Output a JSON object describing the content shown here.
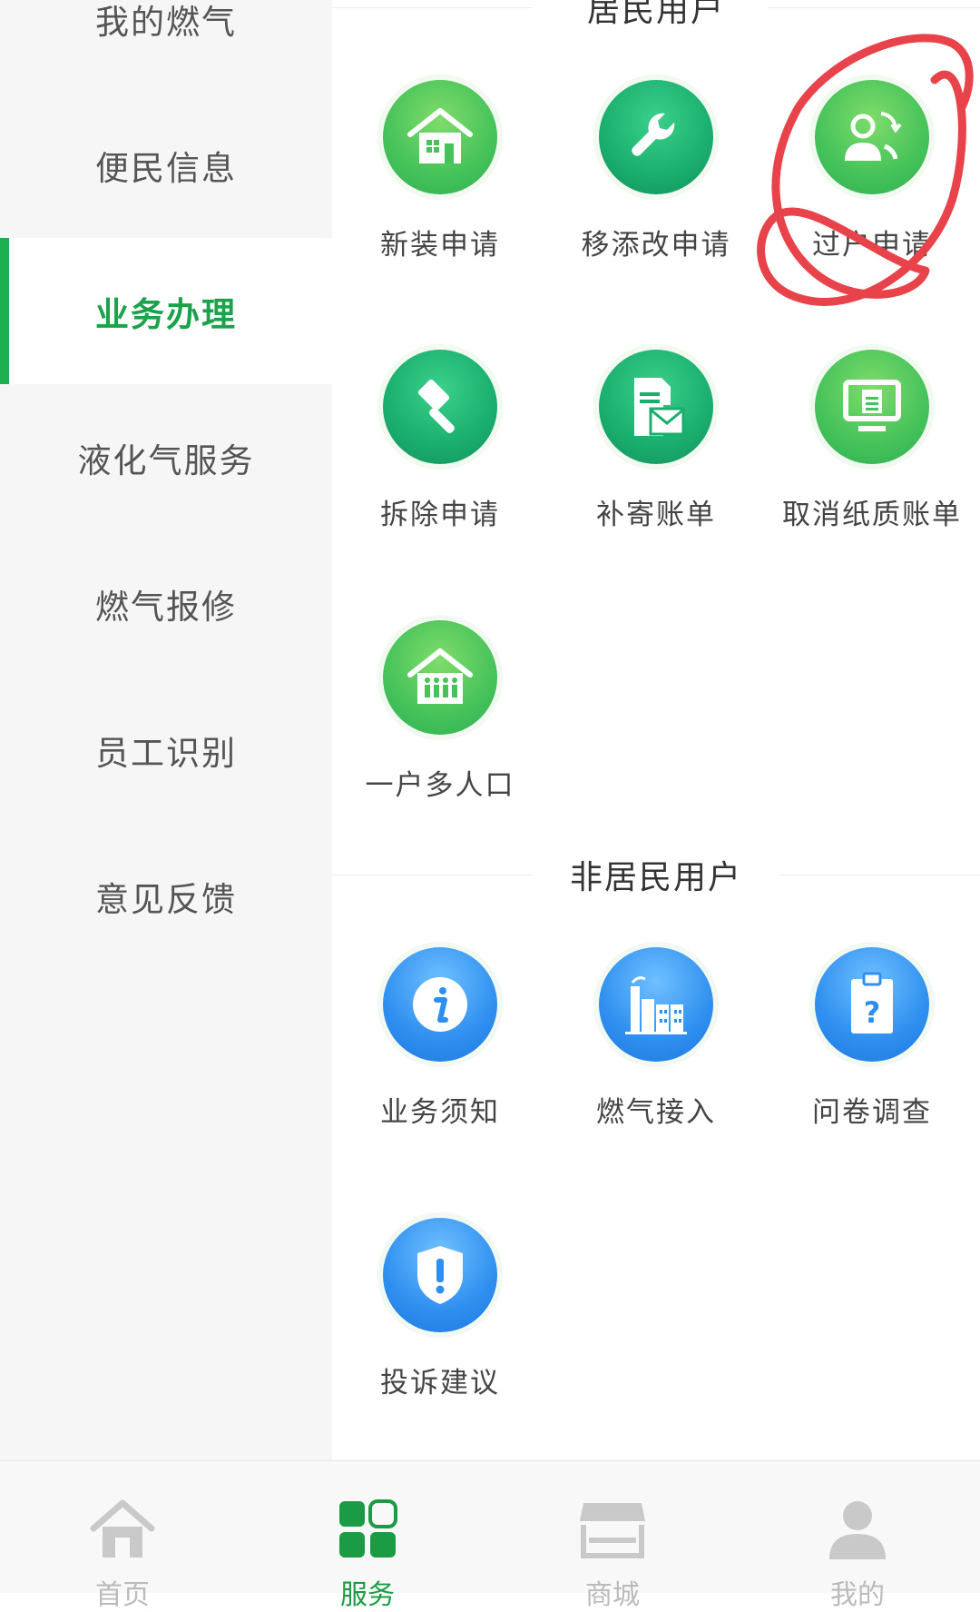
{
  "sidebar": {
    "items": [
      {
        "label": "我的燃气",
        "active": false
      },
      {
        "label": "便民信息",
        "active": false
      },
      {
        "label": "业务办理",
        "active": true
      },
      {
        "label": "液化气服务",
        "active": false
      },
      {
        "label": "燃气报修",
        "active": false
      },
      {
        "label": "员工识别",
        "active": false
      },
      {
        "label": "意见反馈",
        "active": false
      }
    ]
  },
  "main": {
    "resident": {
      "title": "居民用户",
      "services": [
        {
          "label": "新装申请",
          "icon": "house-icon"
        },
        {
          "label": "移添改申请",
          "icon": "wrench-icon"
        },
        {
          "label": "过户申请",
          "icon": "user-transfer-icon"
        },
        {
          "label": "拆除申请",
          "icon": "hammer-icon"
        },
        {
          "label": "补寄账单",
          "icon": "mail-document-icon"
        },
        {
          "label": "取消纸质账单",
          "icon": "monitor-document-icon"
        },
        {
          "label": "一户多人口",
          "icon": "family-house-icon"
        }
      ]
    },
    "nonresident": {
      "title": "非居民用户",
      "services": [
        {
          "label": "业务须知",
          "icon": "info-icon"
        },
        {
          "label": "燃气接入",
          "icon": "factory-icon"
        },
        {
          "label": "问卷调查",
          "icon": "clipboard-question-icon"
        },
        {
          "label": "投诉建议",
          "icon": "shield-alert-icon"
        }
      ]
    }
  },
  "bottom_nav": {
    "items": [
      {
        "label": "首页",
        "icon": "home-icon",
        "active": false
      },
      {
        "label": "服务",
        "icon": "grid-icon",
        "active": true
      },
      {
        "label": "商城",
        "icon": "store-icon",
        "active": false
      },
      {
        "label": "我的",
        "icon": "person-icon",
        "active": false
      }
    ]
  },
  "colors": {
    "accent": "#1aa34a",
    "green_icon": "#45c25a",
    "teal_icon": "#1aae6e",
    "blue_icon": "#2f8fef",
    "annotation": "#e8434b"
  }
}
